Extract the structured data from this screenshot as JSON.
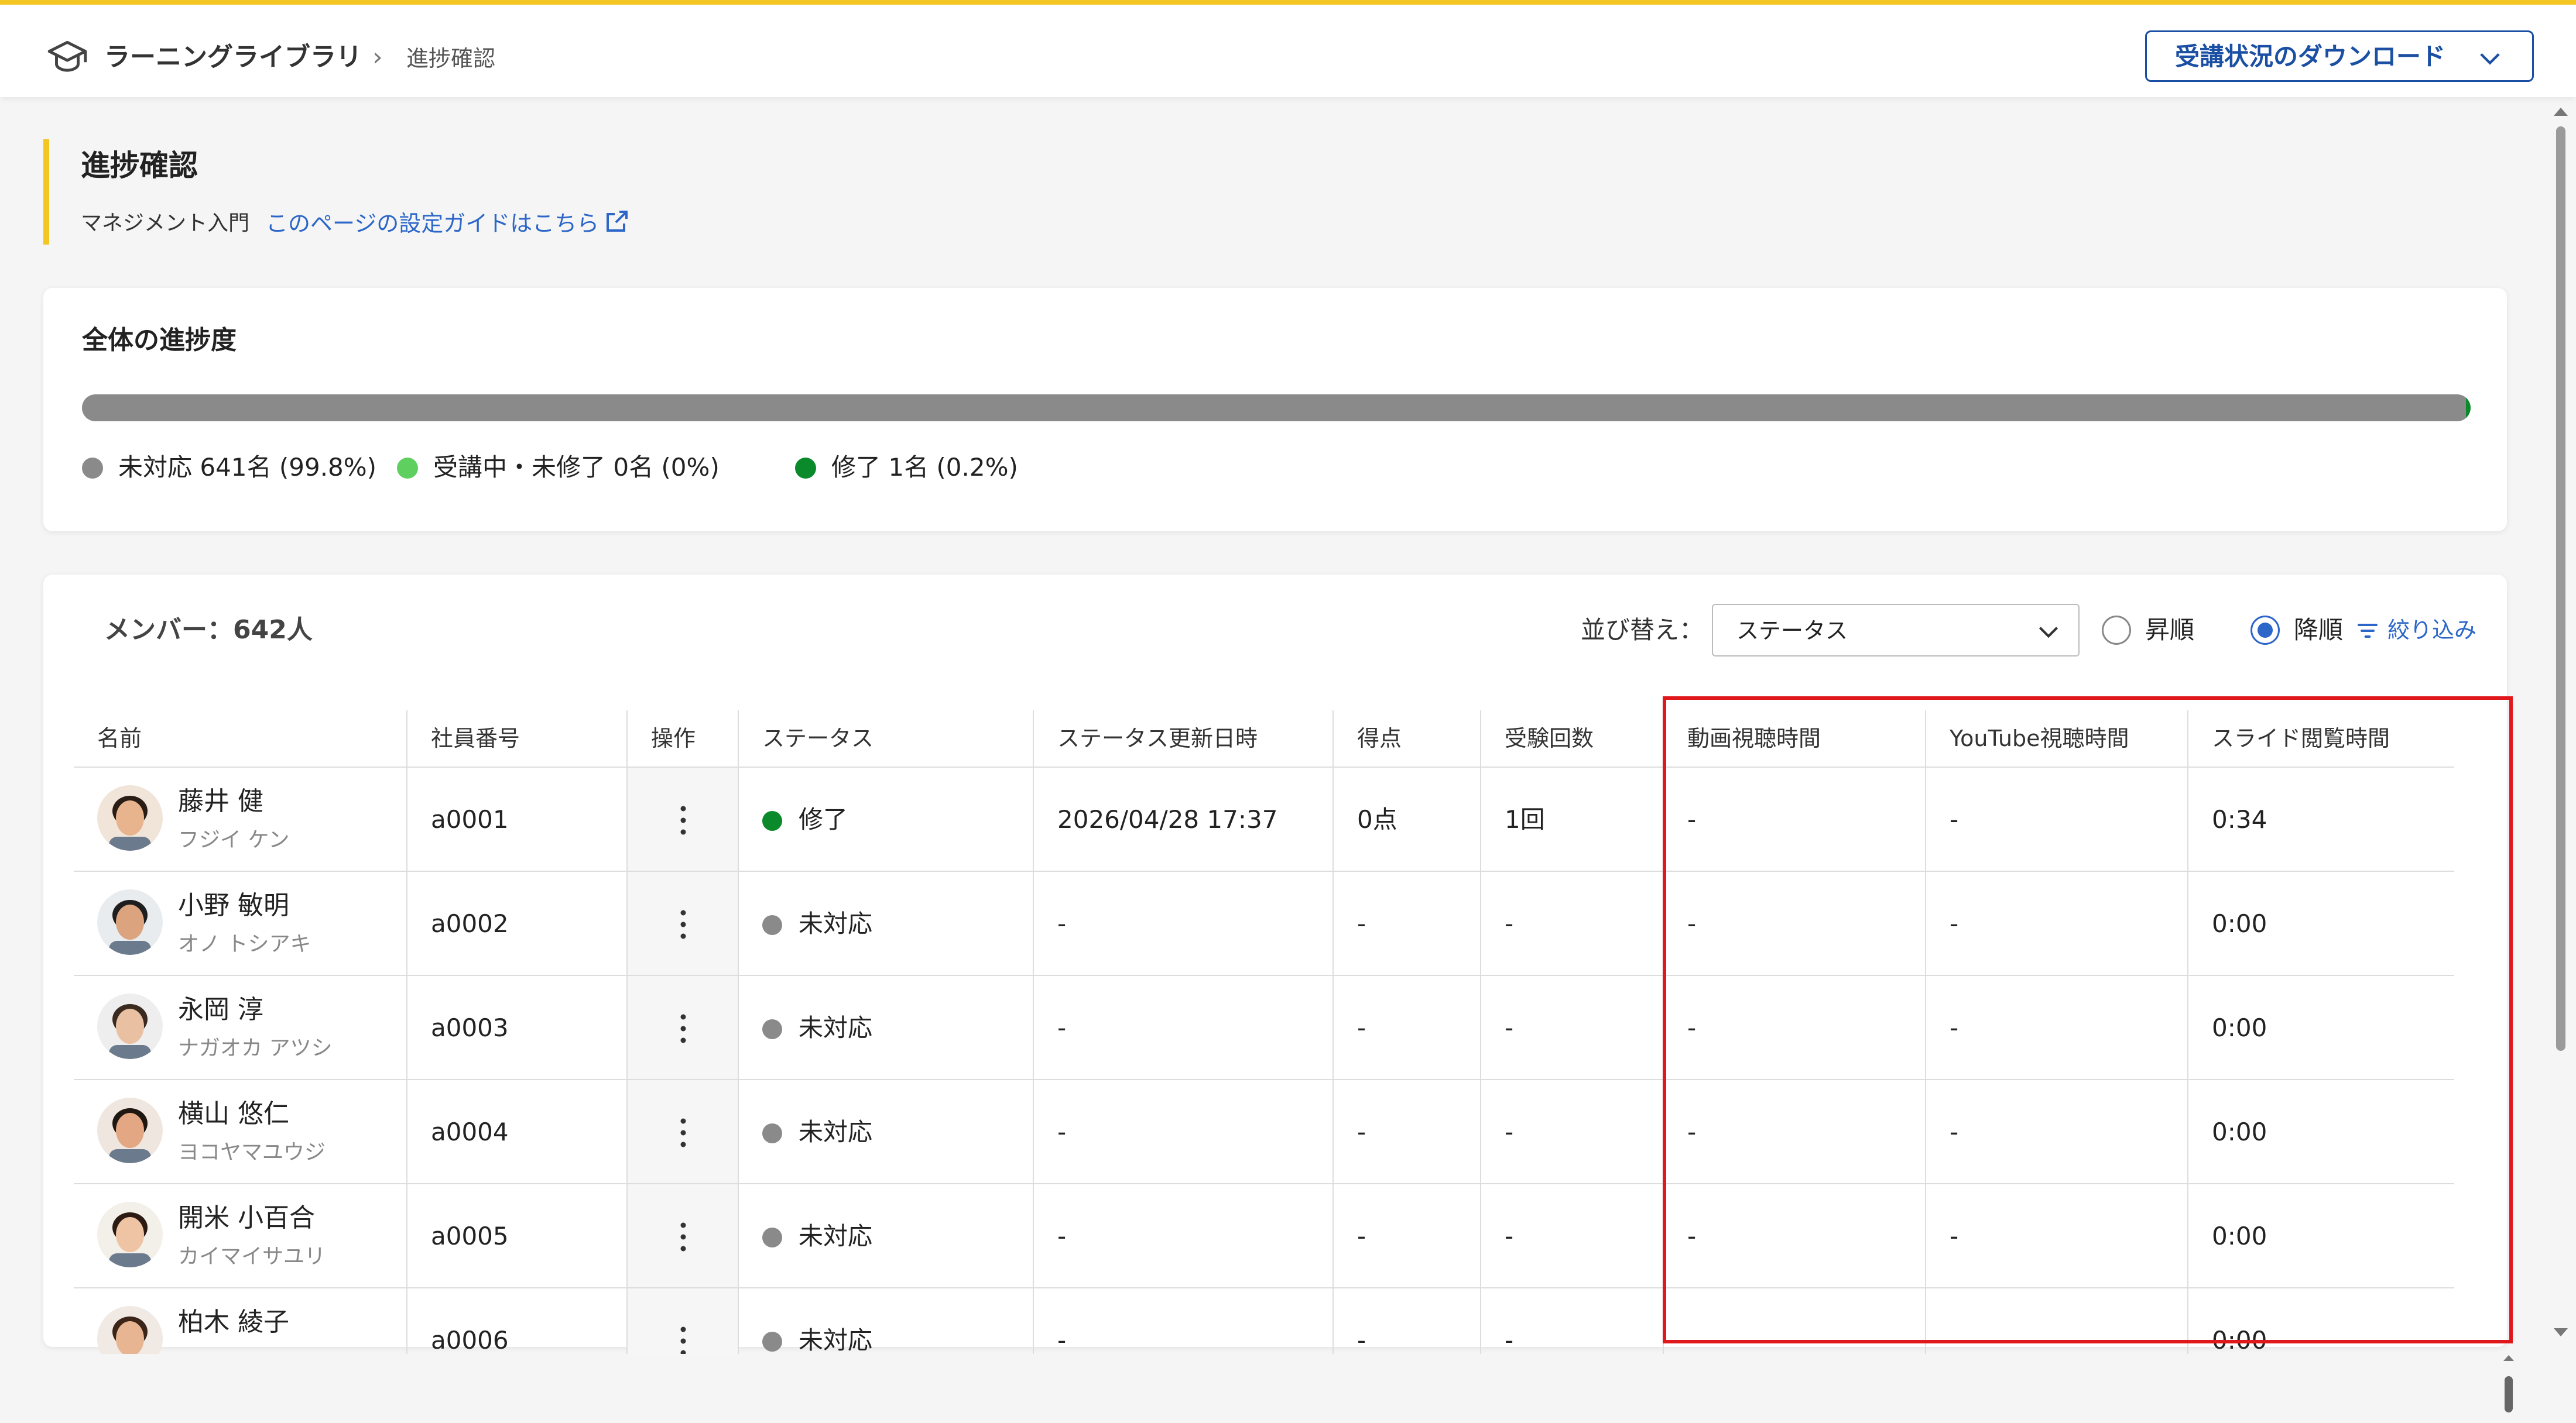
{
  "header": {
    "app_name": "ラーニングライブラリ",
    "breadcrumb_separator": "›",
    "breadcrumb_current": "進捗確認",
    "download_button": "受講状況のダウンロード"
  },
  "page": {
    "title": "進捗確認",
    "course_name": "マネジメント入門",
    "guide_link": "このページの設定ガイドはこちら"
  },
  "progress": {
    "title": "全体の進捗度",
    "fractions": {
      "not_started": 0.998,
      "in_progress": 0.0,
      "completed": 0.002
    },
    "legend": [
      {
        "label": "未対応 641名 (99.8%)",
        "color": "#8a8a8a"
      },
      {
        "label": "受講中・未修了 0名 (0%)",
        "color": "#5fcf5f"
      },
      {
        "label": "修了 1名 (0.2%)",
        "color": "#0a8a2a"
      }
    ]
  },
  "members": {
    "count_label": "メンバー：642人",
    "sort_label": "並び替え：",
    "sort_value": "ステータス",
    "order_asc": "昇順",
    "order_desc": "降順",
    "order_selected": "desc",
    "filter_label": "絞り込み",
    "columns": [
      "名前",
      "社員番号",
      "操作",
      "ステータス",
      "ステータス更新日時",
      "得点",
      "受験回数",
      "動画視聴時間",
      "YouTube視聴時間",
      "スライド閲覧時間"
    ],
    "rows": [
      {
        "name": "藤井 健",
        "kana": "フジイ ケン",
        "id": "a0001",
        "status": "修了",
        "status_color": "#0a8a2a",
        "updated": "2026/04/28 17:37",
        "score": "0点",
        "attempts": "1回",
        "video": "-",
        "youtube": "-",
        "slide": "0:34"
      },
      {
        "name": "小野 敏明",
        "kana": "オノ トシアキ",
        "id": "a0002",
        "status": "未対応",
        "status_color": "#8a8a8a",
        "updated": "-",
        "score": "-",
        "attempts": "-",
        "video": "-",
        "youtube": "-",
        "slide": "0:00"
      },
      {
        "name": "永岡 淳",
        "kana": "ナガオカ アツシ",
        "id": "a0003",
        "status": "未対応",
        "status_color": "#8a8a8a",
        "updated": "-",
        "score": "-",
        "attempts": "-",
        "video": "-",
        "youtube": "-",
        "slide": "0:00"
      },
      {
        "name": "横山 悠仁",
        "kana": "ヨコヤマユウジ",
        "id": "a0004",
        "status": "未対応",
        "status_color": "#8a8a8a",
        "updated": "-",
        "score": "-",
        "attempts": "-",
        "video": "-",
        "youtube": "-",
        "slide": "0:00"
      },
      {
        "name": "開米 小百合",
        "kana": "カイマイサユリ",
        "id": "a0005",
        "status": "未対応",
        "status_color": "#8a8a8a",
        "updated": "-",
        "score": "-",
        "attempts": "-",
        "video": "-",
        "youtube": "-",
        "slide": "0:00"
      },
      {
        "name": "柏木 綾子",
        "kana": "",
        "id": "a0006",
        "status": "未対応",
        "status_color": "#8a8a8a",
        "updated": "-",
        "score": "-",
        "attempts": "-",
        "video": "-",
        "youtube": "-",
        "slide": "0:00"
      }
    ]
  }
}
